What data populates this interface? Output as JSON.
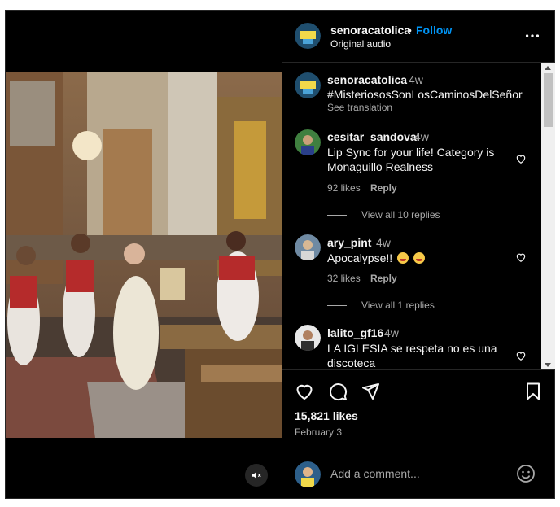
{
  "post": {
    "username": "senoracatolica",
    "dot": "•",
    "follow_label": "Follow",
    "audio": "Original audio",
    "more_label": "More options"
  },
  "caption": {
    "username": "senoracatolica",
    "time": "4w",
    "text": "#MisteriososSonLosCaminosDelSeñor",
    "translate": "See translation"
  },
  "comments": [
    {
      "username": "cesitar_sandoval",
      "time": "4w",
      "text": "Lip Sync for your life! Category is Monaguillo Realness",
      "likes": "92 likes",
      "reply": "Reply",
      "view_replies": "View all 10 replies"
    },
    {
      "username": "ary_pint",
      "time": "4w",
      "text": "Apocalypse!!",
      "emoji_count": 2,
      "likes": "32 likes",
      "reply": "Reply",
      "view_replies": "View all 1 replies"
    },
    {
      "username": "lalito_gf16",
      "time": "4w",
      "text": "LA IGLESIA se respeta no es una discoteca"
    }
  ],
  "actions": {
    "like_icon": "heart-outline-icon",
    "comment_icon": "comment-bubble-icon",
    "share_icon": "paper-plane-icon",
    "save_icon": "bookmark-icon"
  },
  "stats": {
    "likes": "15,821 likes",
    "date": "February 3"
  },
  "composer": {
    "placeholder": "Add a comment..."
  },
  "media": {
    "mute_icon": "speaker-muted-icon"
  },
  "colors": {
    "accent": "#0095f6",
    "background": "#000000",
    "muted_text": "#a8a8a8",
    "border": "#262626"
  }
}
